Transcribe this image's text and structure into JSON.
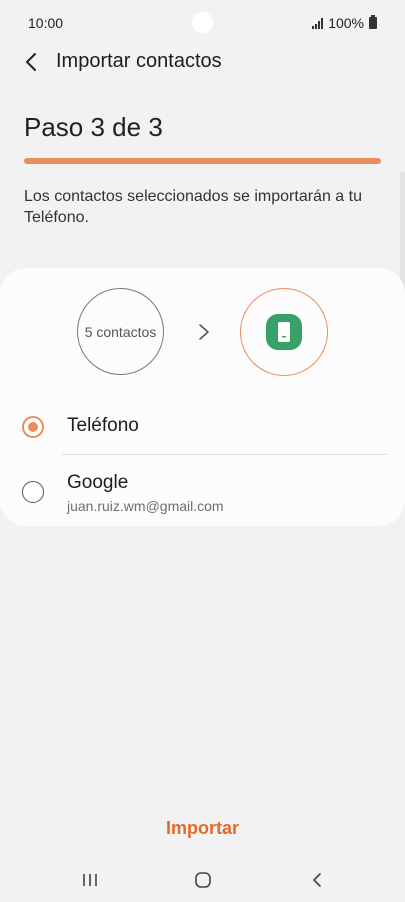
{
  "status": {
    "time": "10:00",
    "battery": "100%"
  },
  "header": {
    "title": "Importar contactos",
    "back_icon": "chevron-left-icon"
  },
  "step": {
    "title": "Paso 3 de 3",
    "progress": 1.0
  },
  "description": "Los contactos seleccionados se importarán a tu Teléfono.",
  "transfer": {
    "source_label": "5 contactos",
    "arrow_icon": "chevron-right-icon",
    "target_icon": "phone-icon"
  },
  "options": [
    {
      "label": "Teléfono",
      "sub": "",
      "selected": true
    },
    {
      "label": "Google",
      "sub": "juan.ruiz.wm@gmail.com",
      "selected": false
    }
  ],
  "actions": {
    "import_label": "Importar"
  },
  "navbar": {
    "recents_icon": "recents-icon",
    "home_icon": "home-icon",
    "back_icon": "back-icon"
  },
  "colors": {
    "accent": "#ec8b5e",
    "accent_text": "#e26a2c",
    "phone_green": "#3aa06a",
    "background": "#f2f2f2"
  }
}
